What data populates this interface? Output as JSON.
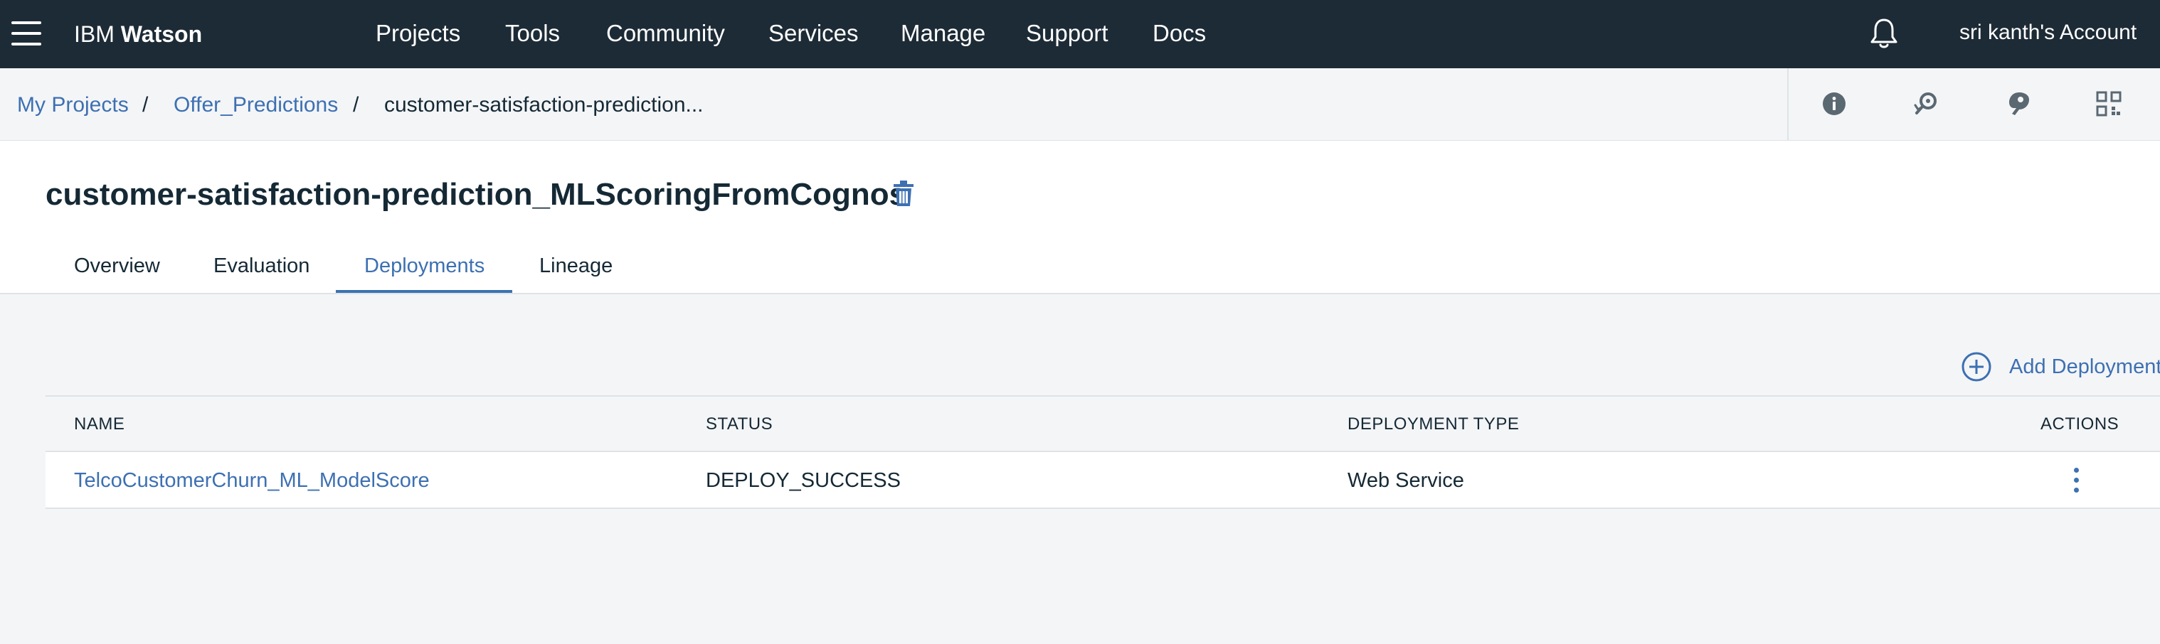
{
  "topbar": {
    "brand_prefix": "IBM",
    "brand_name": "Watson",
    "nav": [
      "Projects",
      "Tools",
      "Community",
      "Services",
      "Manage",
      "Support",
      "Docs"
    ],
    "account": "sri kanth's Account"
  },
  "breadcrumb": {
    "items": [
      "My Projects",
      "Offer_Predictions",
      "customer-satisfaction-prediction..."
    ],
    "separator": "/"
  },
  "toolbar": {
    "icons": [
      "info-icon",
      "find-icon",
      "palette-icon",
      "grid-icon"
    ]
  },
  "header": {
    "title": "customer-satisfaction-prediction_MLScoringFromCognos",
    "tabs": [
      "Overview",
      "Evaluation",
      "Deployments",
      "Lineage"
    ],
    "active_tab": "Deployments"
  },
  "deployments": {
    "add_label": "Add Deployment",
    "columns": [
      "NAME",
      "STATUS",
      "DEPLOYMENT TYPE",
      "ACTIONS"
    ],
    "rows": [
      {
        "name": "TelcoCustomerChurn_ML_ModelScore",
        "status": "DEPLOY_SUCCESS",
        "type": "Web Service"
      }
    ]
  },
  "colors": {
    "topbar_bg": "#1d2b36",
    "accent": "#3d70b2",
    "text": "#152935",
    "page_bg": "#f4f5f7",
    "border": "#dfe3e6"
  }
}
